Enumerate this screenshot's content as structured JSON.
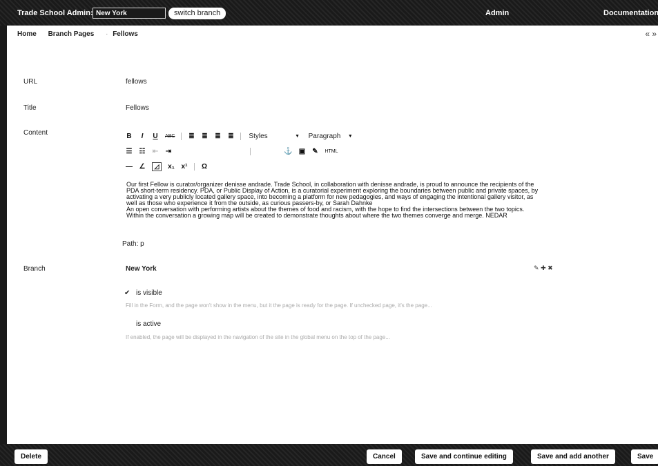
{
  "header": {
    "site_title": "Trade School Admin:",
    "branch_value": "New York",
    "switch_label": "switch branch",
    "admin_label": "Admin",
    "docs_label": "Documentation"
  },
  "breadcrumb": [
    "Home",
    "Branch Pages",
    "Fellows"
  ],
  "breadcrumb_sep": "·",
  "collapse_icon": "« »",
  "form": {
    "url_label": "URL",
    "url_value": "fellows",
    "title_label": "Title",
    "title_value": "Fellows",
    "content_label": "Content",
    "styles_label": "Styles",
    "paragraph_label": "Paragraph",
    "editor_text": "Our first Fellow is curator/organizer denisse andrade. Trade School, in collaboration with denisse andrade, is proud to announce the recipients of the PDA short-term residency. PDA, or Public Display of Action, is a curatorial experiment exploring the boundaries between public and private spaces, by activating a very publicly located gallery space, into becoming a platform for new pedagogies, and ways of engaging the intentional gallery visitor, as well as those who experience it from the outside, as curious passers-by, or Sarah Dahnke\nAn open conversation with performing artists about the themes of food and racism, with the hope to find the intersections between the two topics. Within the conversation a growing map will be created to demonstrate thoughts about where the two themes converge and merge. NEDAR",
    "path_label": "Path: p",
    "branch_label": "Branch",
    "branch_value": "New York",
    "visible_label": "is visible",
    "visible_help": "Fill in the Form, and the page won't show in the menu, but it the page is ready for the page. If unchecked page, it's the page...",
    "active_label": "is active",
    "active_help": "If enabled, the page will be displayed in the navigation of the site in the global menu on the top of the page..."
  },
  "footer": {
    "delete_label": "Delete",
    "cancel_label": "Cancel",
    "save_continue_label": "Save and continue editing",
    "save_add_label": "Save and add another",
    "save_label": "Save"
  }
}
